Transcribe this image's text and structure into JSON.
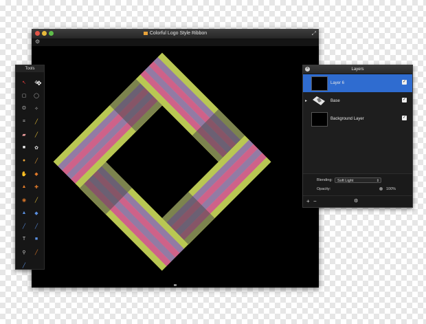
{
  "window": {
    "title": "Colorful Logo Style Ribbon",
    "settings_icon": "gear-icon",
    "fullscreen_icon": "fullscreen-icon"
  },
  "tools": {
    "title": "Tools",
    "items": [
      {
        "icon": "arrow-icon",
        "glyph": "↖",
        "color": "#e23b3b"
      },
      {
        "icon": "move-icon",
        "glyph": "✥",
        "color": "#bbbbbb"
      },
      {
        "icon": "rect-select-icon",
        "glyph": "▢",
        "color": "#bbbbbb"
      },
      {
        "icon": "ellipse-select-icon",
        "glyph": "◯",
        "color": "#bbbbbb"
      },
      {
        "icon": "lasso-icon",
        "glyph": "ʘ",
        "color": "#bbbbbb"
      },
      {
        "icon": "magic-wand-icon",
        "glyph": "✧",
        "color": "#bbbbbb"
      },
      {
        "icon": "crop-icon",
        "glyph": "⌗",
        "color": "#bbbbbb"
      },
      {
        "icon": "eyedropper-icon",
        "glyph": "╱",
        "color": "#e8c23a"
      },
      {
        "icon": "eraser-icon",
        "glyph": "▰",
        "color": "#f0a0a0"
      },
      {
        "icon": "pencil-icon",
        "glyph": "╱",
        "color": "#e8c23a"
      },
      {
        "icon": "fill-rect-icon",
        "glyph": "■",
        "color": "#eeeeee"
      },
      {
        "icon": "stamp-icon",
        "glyph": "✿",
        "color": "#dddddd"
      },
      {
        "icon": "sponge-icon",
        "glyph": "●",
        "color": "#e8a23a"
      },
      {
        "icon": "brush-icon",
        "glyph": "╱",
        "color": "#e8a23a"
      },
      {
        "icon": "smudge-icon",
        "glyph": "✋",
        "color": "#e8a23a"
      },
      {
        "icon": "burn-icon",
        "glyph": "◆",
        "color": "#e07a2a"
      },
      {
        "icon": "clone-icon",
        "glyph": "▲",
        "color": "#e07a2a"
      },
      {
        "icon": "heal-icon",
        "glyph": "✚",
        "color": "#e07a2a"
      },
      {
        "icon": "red-eye-icon",
        "glyph": "◉",
        "color": "#e07a2a"
      },
      {
        "icon": "blur-icon",
        "glyph": "╱",
        "color": "#e8c23a"
      },
      {
        "icon": "sharpen-icon",
        "glyph": "▲",
        "color": "#5a8fe0"
      },
      {
        "icon": "drop-icon",
        "glyph": "◆",
        "color": "#5a8fe0"
      },
      {
        "icon": "line-icon",
        "glyph": "╱",
        "color": "#5a8fe0"
      },
      {
        "icon": "gradient-icon",
        "glyph": "╱",
        "color": "#5a8fe0"
      },
      {
        "icon": "text-icon",
        "glyph": "T",
        "color": "#cccccc"
      },
      {
        "icon": "shape-icon",
        "glyph": "■",
        "color": "#5a8fe0"
      },
      {
        "icon": "zoom-icon",
        "glyph": "⚲",
        "color": "#cccccc"
      },
      {
        "icon": "pen-icon",
        "glyph": "╱",
        "color": "#e07a2a"
      },
      {
        "icon": "hand-icon",
        "glyph": "╱",
        "color": "#5a8fe0"
      }
    ]
  },
  "layers": {
    "title": "Layers",
    "rows": [
      {
        "name": "Layer 6",
        "selected": true
      },
      {
        "name": "Base",
        "selected": false
      },
      {
        "name": "Background Layer",
        "selected": false
      }
    ],
    "blending_label": "Blending:",
    "blending_value": "Soft Light",
    "opacity_label": "Opacity:",
    "opacity_value": "100%",
    "check_glyph": "✓",
    "add_glyph": "+",
    "remove_glyph": "−",
    "settings_glyph": "⚙",
    "close_glyph": "×",
    "expand_glyph": "▸"
  },
  "artwork": {
    "stripe_colors": [
      "#c9d85a",
      "#9e86b2",
      "#e06a95",
      "#9e86b2",
      "#e06a95",
      "#c9d85a"
    ],
    "shadow_color": "#4a4a4a"
  }
}
